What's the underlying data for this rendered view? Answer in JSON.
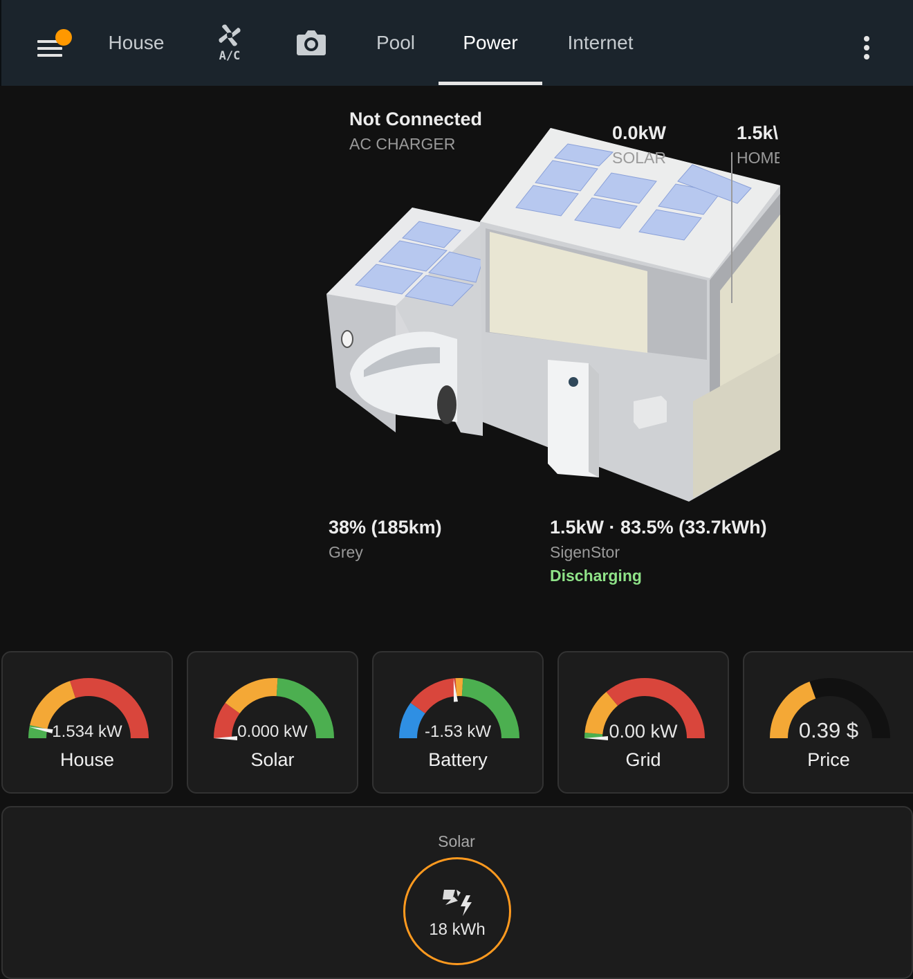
{
  "app": {
    "tabs": [
      {
        "label": "House",
        "type": "text"
      },
      {
        "label": "",
        "icon": "fan-ac-icon",
        "type": "icon"
      },
      {
        "label": "",
        "icon": "camera-icon",
        "type": "icon"
      },
      {
        "label": "Pool",
        "type": "text"
      },
      {
        "label": "Power",
        "type": "text",
        "active": true
      },
      {
        "label": "Internet",
        "type": "text"
      }
    ],
    "ac_icon_text": "A/C",
    "accent": "#ff9800"
  },
  "flow": {
    "charger": {
      "value": "Not Connected",
      "label": "AC CHARGER"
    },
    "solar": {
      "value": "0.0kW",
      "label": "SOLAR"
    },
    "home": {
      "value": "1.5k\\",
      "label": "HOME"
    },
    "car": {
      "value": "38% (185km)",
      "label": "Grey"
    },
    "battery": {
      "value": "1.5kW · 83.5% (33.7kWh)",
      "label": "SigenStor",
      "status": "Discharging",
      "status_color": "#8fe388"
    }
  },
  "gauges": [
    {
      "name": "House",
      "value": "1.534 kW",
      "needle": 0.06,
      "segments": [
        [
          "#4caf50",
          0,
          0.07
        ],
        [
          "#f4a836",
          0.07,
          0.4
        ],
        [
          "#d9463c",
          0.4,
          1
        ]
      ]
    },
    {
      "name": "Solar",
      "value": "0.000 kW",
      "needle": 0.0,
      "segments": [
        [
          "#d9463c",
          0,
          0.2
        ],
        [
          "#f4a836",
          0.2,
          0.52
        ],
        [
          "#4caf50",
          0.52,
          1
        ]
      ]
    },
    {
      "name": "Battery",
      "value": "-1.53 kW",
      "needle": 0.47,
      "segments": [
        [
          "#2f8fe3",
          0,
          0.2
        ],
        [
          "#d9463c",
          0.2,
          0.48
        ],
        [
          "#f4a836",
          0.48,
          0.52
        ],
        [
          "#4caf50",
          0.52,
          1
        ]
      ]
    },
    {
      "name": "Grid",
      "value": "0.00 kW",
      "needle": 0.0,
      "segments": [
        [
          "#4caf50",
          0,
          0.03
        ],
        [
          "#f4a836",
          0.03,
          0.28
        ],
        [
          "#d9463c",
          0.28,
          1
        ]
      ]
    },
    {
      "name": "Price",
      "value": "0.39 $",
      "needle": null,
      "fill": 0.39,
      "segments": [
        [
          "#f4a836",
          0,
          0.39
        ],
        [
          "#111111",
          0.39,
          1
        ]
      ]
    }
  ],
  "solar_card": {
    "title": "Solar",
    "value": "18 kWh",
    "icon": "solar-power-icon",
    "ring_color": "#ff9a1f"
  }
}
